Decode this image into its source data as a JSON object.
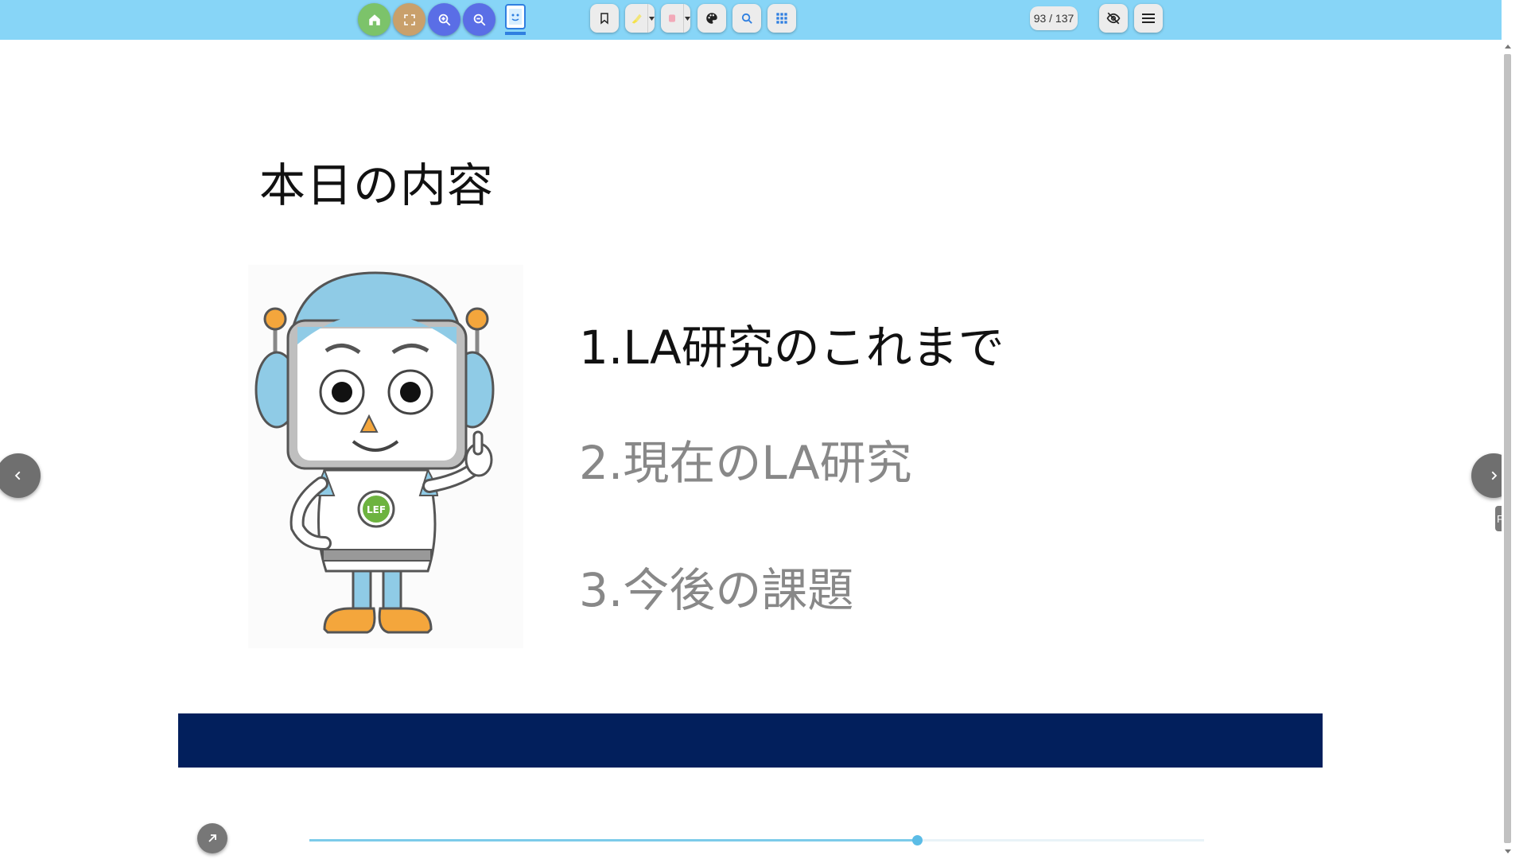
{
  "toolbar": {
    "bg_color": "#87d5f7",
    "buttons": [
      {
        "name": "home-icon",
        "color": "#7cc36a"
      },
      {
        "name": "fullscreen-icon",
        "color": "#c9a06b"
      },
      {
        "name": "zoom-in-icon",
        "color": "#5a6ee6"
      },
      {
        "name": "zoom-out-icon",
        "color": "#5a6ee6"
      },
      {
        "name": "dictionary-icon"
      },
      {
        "name": "bookmark-icon"
      },
      {
        "name": "highlighter-icon",
        "color": "#f5e24a"
      },
      {
        "name": "eraser-icon",
        "color": "#f2a9b8"
      },
      {
        "name": "palette-icon"
      },
      {
        "name": "search-icon"
      },
      {
        "name": "grid-icon",
        "color": "#2f7fe0"
      },
      {
        "name": "eye-off-icon"
      },
      {
        "name": "menu-icon"
      }
    ],
    "page_counter": "93 / 137"
  },
  "slide": {
    "title": "本日の内容",
    "agenda": [
      {
        "label": "1.LA研究のこれまで",
        "active": true
      },
      {
        "label": "2.現在のLA研究",
        "active": false
      },
      {
        "label": "3.今後の課題",
        "active": false
      }
    ],
    "mascot_badge": "LEF",
    "footer_band_color": "#021f5c"
  },
  "side_tab": {
    "label": "F"
  },
  "progress": {
    "current_page": 93,
    "total_pages": 137,
    "fraction": 0.679
  }
}
